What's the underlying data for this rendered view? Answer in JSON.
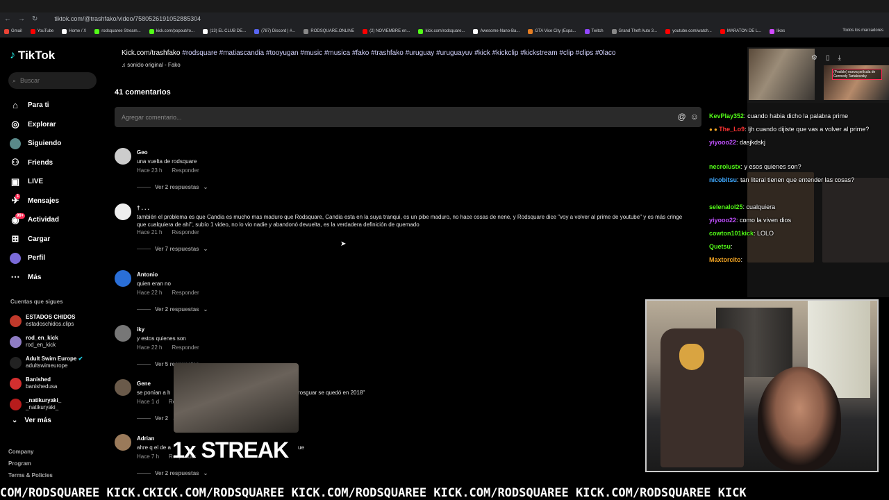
{
  "browser": {
    "url": "tiktok.com/@trashfako/video/7580526191052885304",
    "bookmarks": [
      {
        "label": "Gmail",
        "color": "#ea4335"
      },
      {
        "label": "YouTube",
        "color": "#ff0000"
      },
      {
        "label": "Home / X",
        "color": "#ffffff"
      },
      {
        "label": "rodsquaree Stream...",
        "color": "#53fc18"
      },
      {
        "label": "kick.com/popout/ro...",
        "color": "#53fc18"
      },
      {
        "label": "(13) EL CLUB DE...",
        "color": "#ffffff"
      },
      {
        "label": "(787) Discord | #...",
        "color": "#5865f2"
      },
      {
        "label": "RODSQUARE.ONLINE",
        "color": "#888888"
      },
      {
        "label": "(2) NOVIEMBRE en...",
        "color": "#ff0000"
      },
      {
        "label": "kick.com/rodsquare...",
        "color": "#53fc18"
      },
      {
        "label": "Awesome-Nano-Ba...",
        "color": "#ffffff"
      },
      {
        "label": "GTA Vice City (Espa...",
        "color": "#e67e22"
      },
      {
        "label": "Twitch",
        "color": "#9146ff"
      },
      {
        "label": "Grand Theft Auto 3...",
        "color": "#888888"
      },
      {
        "label": "youtube.com/watch...",
        "color": "#ff0000"
      },
      {
        "label": "MARATON DE L...",
        "color": "#ff0000"
      },
      {
        "label": "likes",
        "color": "#d14aff"
      }
    ],
    "all_bookmarks": "Todos los marcadores"
  },
  "sidebar": {
    "logo": "TikTok",
    "search_placeholder": "Buscar",
    "nav": [
      {
        "label": "Para ti",
        "icon": "home-icon",
        "glyph": "⌂"
      },
      {
        "label": "Explorar",
        "icon": "compass-icon",
        "glyph": "◎"
      },
      {
        "label": "Siguiendo",
        "icon": "following-avatar-icon",
        "glyph": "●"
      },
      {
        "label": "Friends",
        "icon": "friends-icon",
        "glyph": "⚇"
      },
      {
        "label": "LIVE",
        "icon": "live-icon",
        "glyph": "▣"
      },
      {
        "label": "Mensajes",
        "icon": "messages-icon",
        "glyph": "✈",
        "badge": "1"
      },
      {
        "label": "Actividad",
        "icon": "activity-icon",
        "glyph": "◉",
        "badge": "99+"
      },
      {
        "label": "Cargar",
        "icon": "upload-icon",
        "glyph": "⊞"
      },
      {
        "label": "Perfil",
        "icon": "profile-icon",
        "glyph": "●"
      },
      {
        "label": "Más",
        "icon": "more-icon",
        "glyph": "⋯"
      }
    ],
    "following_title": "Cuentas que sigues",
    "following": [
      {
        "name": "ESTADOS CHIDOS",
        "handle": "estadoschidos.clips",
        "color": "#c0392b"
      },
      {
        "name": "rod_en_kick",
        "handle": "rod_en_kick",
        "color": "#8e7cc3"
      },
      {
        "name": "Adult Swim Europe",
        "handle": "adultswimeurope",
        "color": "#222222",
        "verified": true
      },
      {
        "name": "Banished",
        "handle": "banishedusa",
        "color": "#d32f2f"
      },
      {
        "name": "_natikuryaki_",
        "handle": "_natikuryaki_",
        "color": "#b71c1c"
      }
    ],
    "see_more": "Ver más",
    "footer": [
      "Company",
      "Program",
      "Terms & Policies"
    ]
  },
  "video": {
    "caption_prefix": "Kick.com/trashfako",
    "caption_tags": "#rodsquare #matiascandia #tooyugan #music #musica #fako #trashfako #uruguay #uruguayuv #kick #kickclip #kickstream #clip #clips #0laco",
    "sound": "sonido original - Fako"
  },
  "comments_section": {
    "count_label": "41 comentarios",
    "input_placeholder": "Agregar comentario...",
    "reply_label": "Responder",
    "items": [
      {
        "user": "Geo",
        "text": "una vuelta de rodsquare",
        "time": "Hace 23 h",
        "replies": "Ver 2 respuestas",
        "color": "#cccccc"
      },
      {
        "user": "† . . .",
        "text": "también el problema es que Candia es mucho mas maduro que Rodsquare, Candia esta en la suya tranqui, es un pibe maduro, no hace cosas de nene, y Rodsquare dice \"voy a volver al prime de youtube\" y es más cringe",
        "text2": "que cualquiera de ahí\", subío 1 video, no lo vio nadie y abandonó devuelta, es la verdadera definición de quemado",
        "time": "Hace 21 h",
        "replies": "Ver 7 respuestas",
        "color": "#eeeeee"
      },
      {
        "user": "Antonio",
        "text": "quien eran no",
        "time": "Hace 22 h",
        "replies": "Ver 2 respuestas",
        "color": "#2a6fd8"
      },
      {
        "user": "iky",
        "text": "y estos quienes son",
        "time": "Hace 22 h",
        "replies": "Ver 5 respuestas",
        "color": "#777777"
      },
      {
        "user": "Gene",
        "text": "se ponían a h",
        "text_tail": "rosguar se quedó en 2018\"",
        "time": "Hace 1 d",
        "replies": "Ver 2",
        "color": "#6a5a4a"
      },
      {
        "user": "Adrian",
        "text": "ahre q el de a",
        "text_tail": "ue",
        "time": "Hace 7 h",
        "replies": "Ver 2 respuestas",
        "color": "#9a7a5a"
      }
    ]
  },
  "overlay": {
    "streak": "1x STREAK"
  },
  "chat": [
    {
      "user": "KevPlay352",
      "msg": "cuando habia dicho la palabra prime",
      "color": "#53fc18"
    },
    {
      "user": "The_Lo9",
      "msg": "ljh cuando dijiste que vas a volver al prime?",
      "color": "#ff3333",
      "badges": true
    },
    {
      "user": "yiyooo22",
      "msg": "dasjkdskj",
      "color": "#c050ff"
    },
    {
      "user": "necrolustx",
      "msg": "y esos quienes son?",
      "color": "#53fc18"
    },
    {
      "user": "nicobitsu",
      "msg": "tan literal tienen que entender las cosas?",
      "color": "#3fa9ff"
    },
    {
      "user": "selenalol25",
      "msg": "cualquiera",
      "color": "#53fc18"
    },
    {
      "user": "yiyooo22",
      "msg": "como la viven dios",
      "color": "#c050ff"
    },
    {
      "user": "cowton101kick",
      "msg": "LOLO",
      "color": "#53fc18"
    },
    {
      "user": "Quetsu",
      "msg": "",
      "color": "#53fc18"
    },
    {
      "user": "Maxtorcito",
      "msg": "",
      "color": "#f5a623"
    }
  ],
  "popup_title": "(Posible) nueva película de Gennedy Tartakovsky",
  "ticker": "COM/RODSQUAREE KICK.CKICK.COM/RODSQUAREE KICK.COM/RODSQUAREE KICK.COM/RODSQUAREE KICK.COM/RODSQUAREE KICK"
}
